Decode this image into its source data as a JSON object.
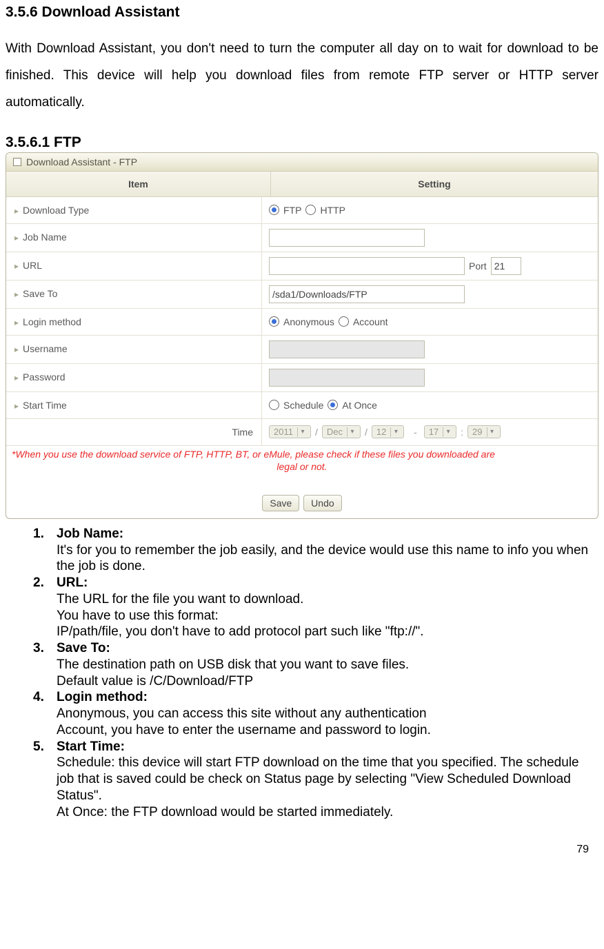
{
  "doc": {
    "h1": "3.5.6 Download Assistant",
    "intro": "With Download Assistant, you don't need to turn the computer all day on to wait for download to be finished. This device will help you download files from remote FTP server or HTTP server automatically.",
    "h2": "3.5.6.1 FTP",
    "page_number": "79"
  },
  "panel": {
    "title": "Download Assistant - FTP",
    "hdr_item": "Item",
    "hdr_setting": "Setting",
    "rows": {
      "download_type": {
        "label": "Download Type",
        "opt_ftp": "FTP",
        "opt_http": "HTTP"
      },
      "job_name": {
        "label": "Job Name",
        "value": ""
      },
      "url": {
        "label": "URL",
        "value": "",
        "port_label": "Port",
        "port_value": "21"
      },
      "save_to": {
        "label": "Save To",
        "value": "/sda1/Downloads/FTP"
      },
      "login_method": {
        "label": "Login method",
        "opt_anon": "Anonymous",
        "opt_acct": "Account"
      },
      "username": {
        "label": "Username",
        "value": ""
      },
      "password": {
        "label": "Password",
        "value": ""
      },
      "start_time": {
        "label": "Start Time",
        "opt_sched": "Schedule",
        "opt_once": "At Once"
      },
      "time": {
        "label": "Time",
        "year": "2011",
        "month": "Dec",
        "day": "12",
        "hour": "17",
        "min": "29"
      }
    },
    "warning_l1": "*When you use the download service of FTP, HTTP, BT, or eMule, please check if these files you downloaded are",
    "warning_l2": "legal or not.",
    "btn_save": "Save",
    "btn_undo": "Undo"
  },
  "list": {
    "i1": {
      "num": "1.",
      "label": "Job Name:",
      "d1": "It's for you to remember the job easily, and the device would use this name to info you when the job is done."
    },
    "i2": {
      "num": "2.",
      "label": "URL:",
      "d1": "The URL for the file you want to download.",
      "d2": "You have to use this format:",
      "d3": "IP/path/file, you don't have to add protocol part such like \"ftp://\"."
    },
    "i3": {
      "num": "3.",
      "label": "Save To:",
      "d1": "The destination path on USB disk that you want to save files.",
      "d2": "Default value is /C/Download/FTP"
    },
    "i4": {
      "num": "4.",
      "label": "Login method:",
      "d1": "Anonymous, you can access this site without any authentication",
      "d2": "Account, you have to enter the username and password to login."
    },
    "i5": {
      "num": "5.",
      "label": "Start Time:",
      "d1": "Schedule: this device will start FTP download on the time that you specified. The schedule job that is saved could be check on Status page by selecting \"View Scheduled Download Status\".",
      "d2": "At Once: the FTP download would be started immediately."
    }
  }
}
